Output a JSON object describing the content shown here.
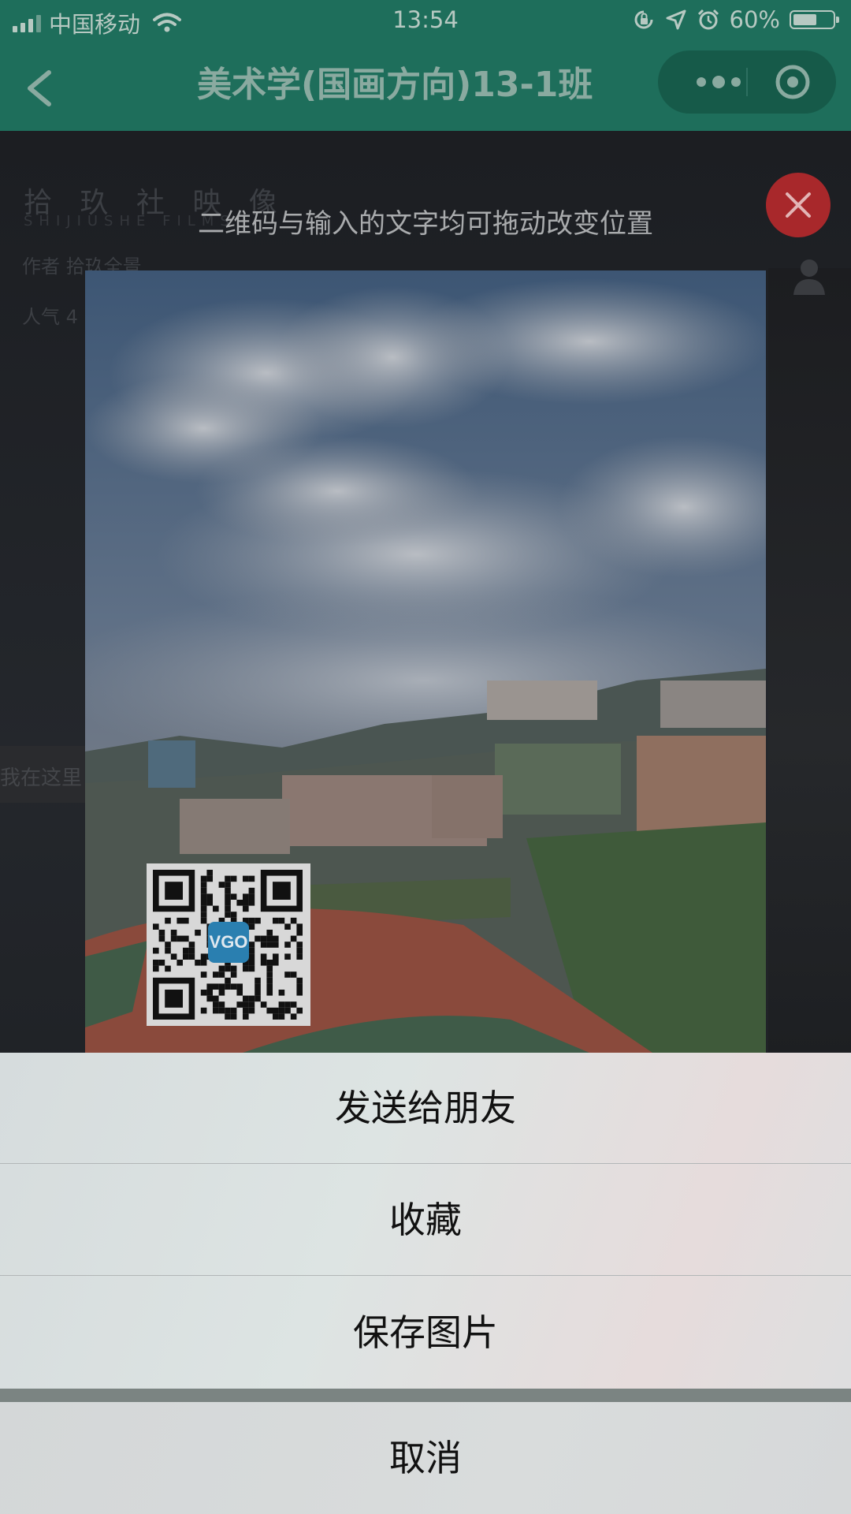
{
  "status_bar": {
    "carrier": "中国移动",
    "time": "13:54",
    "battery": "60%",
    "battery_level": 0.6
  },
  "nav": {
    "title": "美术学(国画方向)13-1班"
  },
  "background": {
    "logo_cn": "拾 玖 社 映 像",
    "logo_en": "SHIJIUSHE FILMS",
    "author": "作者 拾玖全景",
    "popularity": "人气 4",
    "banner_text": "我在这里"
  },
  "overlay": {
    "hint": "二维码与输入的文字均可拖动改变位置",
    "qr_logo": "VGO"
  },
  "action_sheet": {
    "items": [
      "发送给朋友",
      "收藏",
      "保存图片"
    ],
    "cancel": "取消"
  },
  "colors": {
    "nav_green": "#1e6e5b",
    "close_red": "#a8282b"
  }
}
